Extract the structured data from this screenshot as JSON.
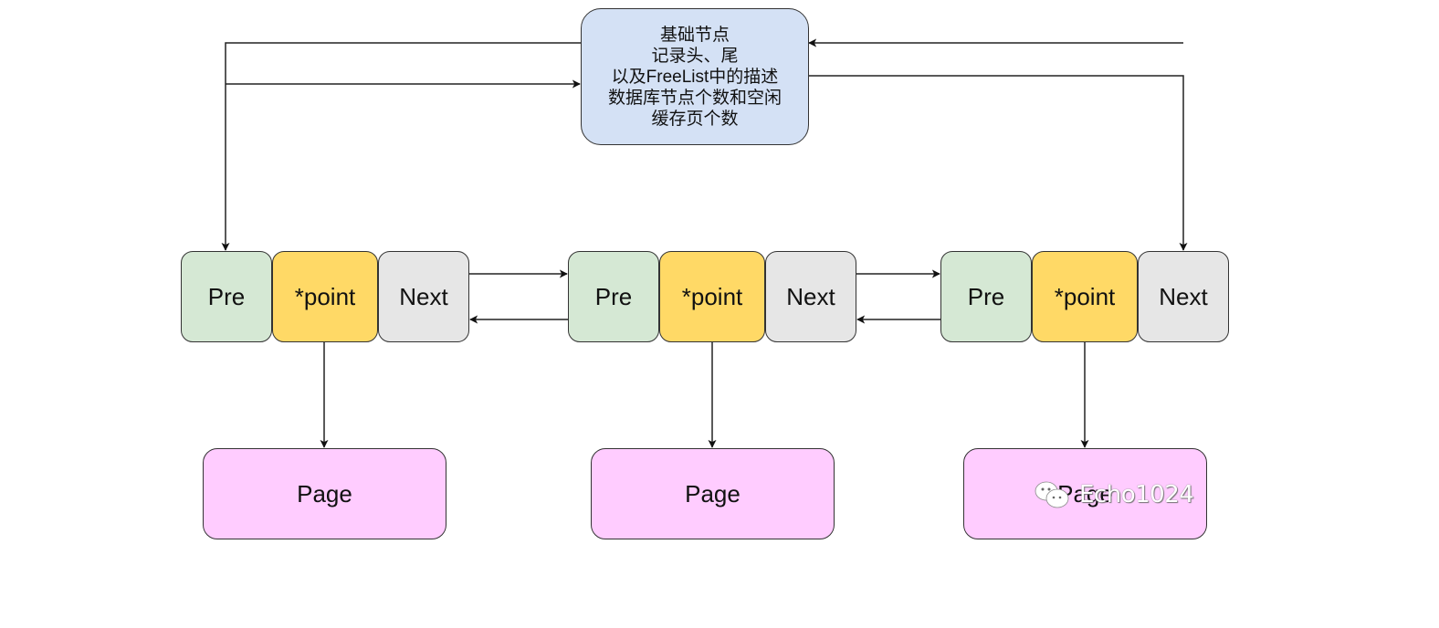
{
  "header_node": {
    "lines": [
      "基础节点",
      "记录头、尾",
      "以及FreeList中的描述",
      "数据库节点个数和空闲",
      "缓存页个数"
    ]
  },
  "nodes": [
    {
      "pre": "Pre",
      "point": "*point",
      "next": "Next",
      "page": "Page"
    },
    {
      "pre": "Pre",
      "point": "*point",
      "next": "Next",
      "page": "Page"
    },
    {
      "pre": "Pre",
      "point": "*point",
      "next": "Next",
      "page": "Page"
    }
  ],
  "watermark": {
    "text": "Echo1024",
    "icon": "wechat-icon"
  },
  "colors": {
    "header_fill": "#d4e1f5",
    "pre_fill": "#d5e8d4",
    "point_fill": "#ffd966",
    "next_fill": "#e6e6e6",
    "page_fill": "#ffccff",
    "stroke": "#333333"
  }
}
